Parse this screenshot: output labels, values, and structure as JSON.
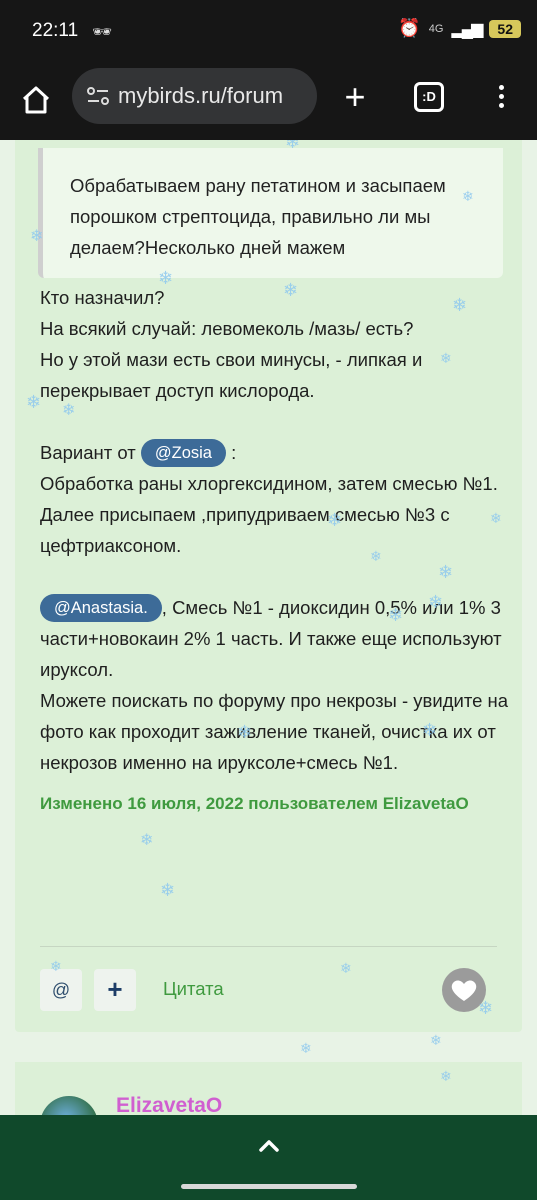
{
  "status_bar": {
    "time": "22:11",
    "network": "4G",
    "battery": "52"
  },
  "browser": {
    "url": "mybirds.ru/forum",
    "tabs_label": ":D"
  },
  "post": {
    "quote_text": "Обрабатываем рану петатином и засыпаем порошком стрептоцида, правильно ли мы делаем?Несколько дней мажем",
    "lines1": [
      "Кто назначил?",
      "На всякий случай: левомеколь /мазь/ есть?",
      "Но у этой мази есть свои минусы, - липкая и перекрывает доступ кислорода."
    ],
    "variant_prefix": "Вариант от",
    "mention1": "@Zosia",
    "variant_suffix": ":",
    "lines2": [
      "Обработка раны хлоргексидином, затем смесью №1.",
      "Далее присыпаем ,припудриваем смесью №3 с цефтриаксоном."
    ],
    "mention2": "@Anastasia.",
    "para3": ", Смесь №1 - диоксидин 0,5% или 1% 3 части+новокаин 2% 1 часть. И также еще используют ируксол.",
    "para4": "Можете поискать по форуму про некрозы - увидите на фото как проходит заживление тканей, очистка их от некрозов именно на ируксоле+смесь №1.",
    "edited": "Изменено 16 июля, 2022 пользователем ElizavetaO"
  },
  "actions": {
    "mention_label": "@",
    "plus_label": "+",
    "quote_label": "Цитата"
  },
  "next_post": {
    "username": "ElizavetaO"
  },
  "colors": {
    "accent_green": "#3f9a3f",
    "mention_bg": "#3d6b98",
    "footer_bg": "#10492b",
    "username": "#d05fd0"
  }
}
